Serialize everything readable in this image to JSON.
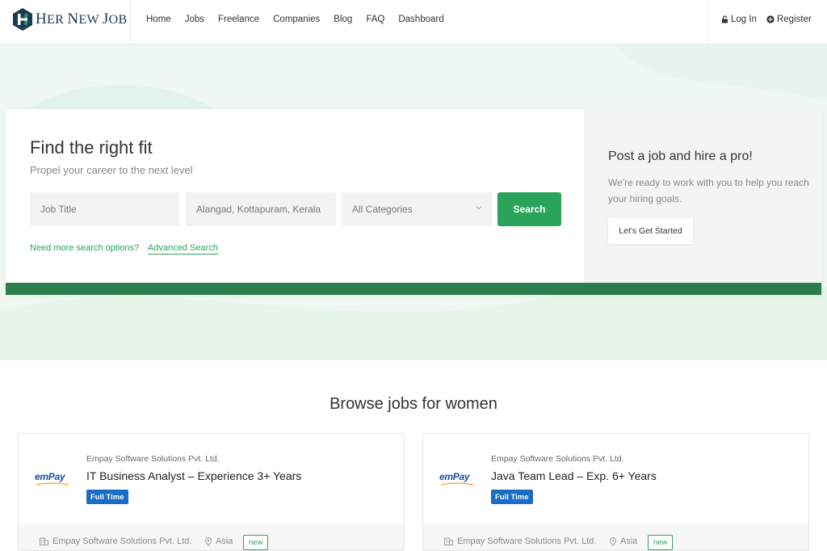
{
  "brand": {
    "name_cap1": "H",
    "name_rest1": "ER ",
    "name_cap2": "N",
    "name_rest2": "EW ",
    "name_cap3": "J",
    "name_rest3": "OB",
    "primary_color": "#2aa45a",
    "dark_green": "#2b7d4b"
  },
  "nav": {
    "items": [
      "Home",
      "Jobs",
      "Freelance",
      "Companies",
      "Blog",
      "FAQ",
      "Dashboard"
    ]
  },
  "auth": {
    "login": "Log In",
    "register": "Register"
  },
  "search": {
    "title": "Find the right fit",
    "subtitle": "Propel your career to the next level",
    "job_title_placeholder": "Job Title",
    "location_value": "Alangad, Kottapuram, Kerala",
    "category_value": "All Categories",
    "button": "Search",
    "more_options": "Need more search options?",
    "advanced_link": "Advanced Search"
  },
  "post": {
    "title": "Post a job and hire a pro!",
    "description": "We're ready to work with you to help you reach your hiring goals.",
    "button": "Let's Get Started"
  },
  "browse": {
    "title": "Browse jobs for women"
  },
  "jobs": [
    {
      "company": "Empay Software Solutions Pvt. Ltd.",
      "logo_text": "emPay",
      "title": "IT Business Analyst – Experience 3+ Years",
      "type": "Full Time",
      "footer_company": "Empay Software Solutions Pvt. Ltd.",
      "location": "Asia",
      "badge": "new"
    },
    {
      "company": "Empay Software Solutions Pvt. Ltd.",
      "logo_text": "emPay",
      "title": "Java Team Lead – Exp. 6+ Years",
      "type": "Full Time",
      "footer_company": "Empay Software Solutions Pvt. Ltd.",
      "location": "Asia",
      "badge": "new"
    }
  ]
}
